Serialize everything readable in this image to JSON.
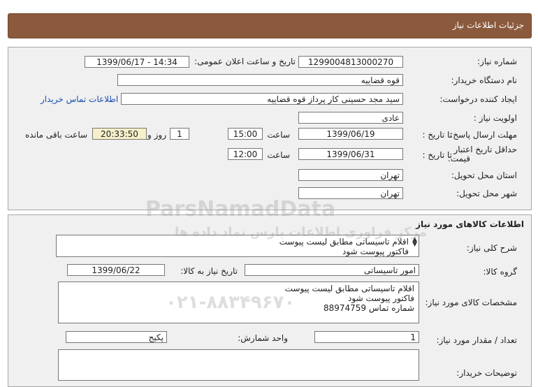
{
  "header": {
    "title": "جزئیات اطلاعات نیاز"
  },
  "details": {
    "need_number_label": "شماره نیاز:",
    "need_number": "1299004813000270",
    "announce_label": "تاریخ و ساعت اعلان عمومی:",
    "announce_value": "1399/06/17 - 14:34",
    "buyer_org_label": "نام دستگاه خریدار:",
    "buyer_org": "قوه قضاییه",
    "creator_label": "ایجاد کننده درخواست:",
    "creator": "سید مجد حسینی کار پرداز  قوه قضاییه",
    "contact_link": "اطلاعات تماس خریدار",
    "priority_label": "اولویت نیاز :",
    "priority": "عادی",
    "send_deadline_label": "مهلت ارسال پاسخ:",
    "to_date_label": "تا تاریخ :",
    "send_date": "1399/06/19",
    "time_label": "ساعت",
    "send_time": "15:00",
    "days_value": "1",
    "days_label": "روز و",
    "remaining_time": "20:33:50",
    "remaining_label": "ساعت باقی مانده",
    "price_validity_label_1": "حداقل تاریخ اعتبار",
    "price_validity_label_2": "قیمت:",
    "price_to_date_label": "تا تاریخ :",
    "price_date": "1399/06/31",
    "price_time_label": "ساعت",
    "price_time": "12:00",
    "province_label": "استان محل تحویل:",
    "province": "تهران",
    "city_label": "شهر محل تحویل:",
    "city": "تهران"
  },
  "goods": {
    "section_title": "اطلاعات کالاهای مورد نیاز",
    "general_desc_label": "شرح کلی نیاز:",
    "general_desc_line1": "اقلام تاسیساتی مطابق لیست پیوست",
    "general_desc_line2": "فاکتور پیوست شود",
    "group_label": "گروه کالا:",
    "group_value": "امور تاسیساتی",
    "need_date_label": "تاریخ نیاز به کالا:",
    "need_date": "1399/06/22",
    "spec_label": "مشخصات کالای مورد نیاز:",
    "spec_line1": "اقلام تاسیساتی مطابق لیست پیوست",
    "spec_line2": "فاکتور پیوست شود",
    "spec_line3": "شماره تماس 88974759",
    "qty_label": "تعداد / مقدار مورد نیاز:",
    "qty_value": "1",
    "unit_label": "واحد شمارش:",
    "unit_value": "پکیج",
    "buyer_notes_label": "توضیحات خریدار:"
  },
  "watermark": {
    "brand": "ParsNamadData",
    "tagline": "مرکز فراوری اطلاعات پارس نماد داده ها",
    "phone": "۰۲۱-۸۸۳۴۹۶۷۰"
  }
}
